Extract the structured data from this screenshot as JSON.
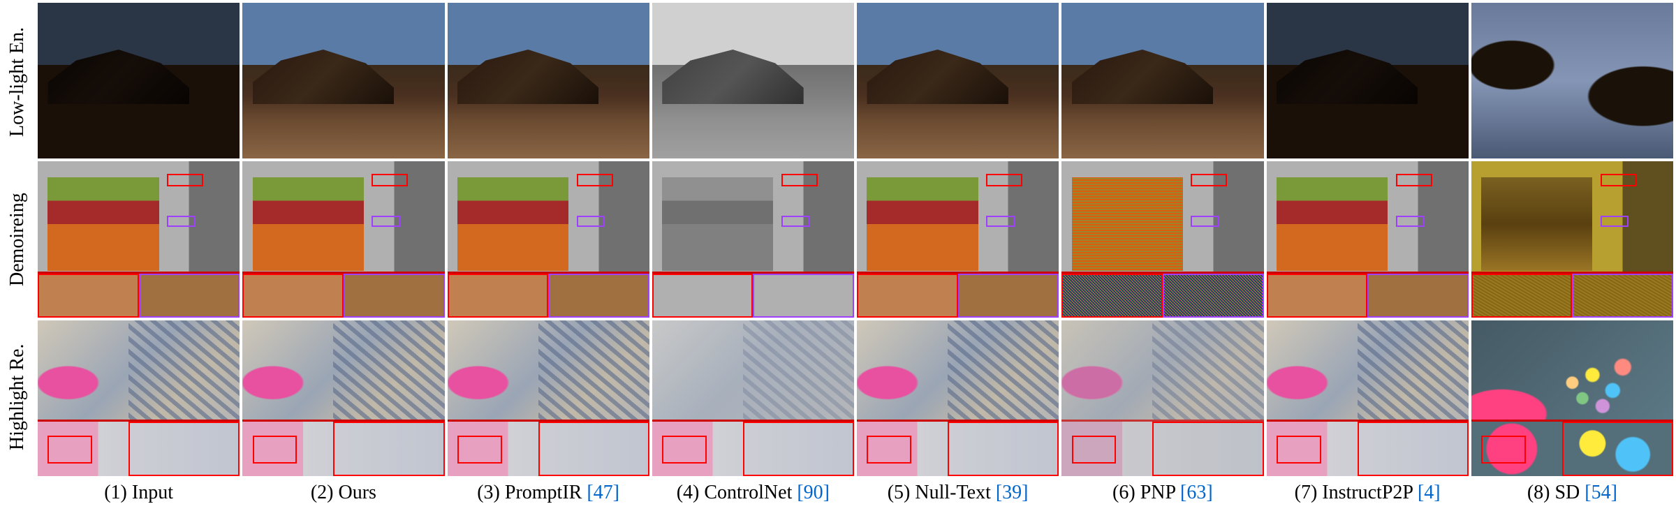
{
  "rows": {
    "r1": "Low-light En.",
    "r2": "Demoireing",
    "r3": "Highlight Re."
  },
  "captions": {
    "c1": {
      "label": "(1) Input",
      "ref": ""
    },
    "c2": {
      "label": "(2) Ours",
      "ref": ""
    },
    "c3": {
      "label": "(3) PromptIR ",
      "ref": "[47]"
    },
    "c4": {
      "label": "(4) ControlNet ",
      "ref": "[90]"
    },
    "c5": {
      "label": "(5) Null-Text ",
      "ref": "[39]"
    },
    "c6": {
      "label": "(6) PNP ",
      "ref": "[63]"
    },
    "c7": {
      "label": "(7) InstructP2P ",
      "ref": "[4]"
    },
    "c8": {
      "label": "(8) SD ",
      "ref": "[54]"
    }
  },
  "grid": {
    "rows": [
      "Low-light En.",
      "Demoireing",
      "Highlight Re."
    ],
    "columns": [
      "Input",
      "Ours",
      "PromptIR",
      "ControlNet",
      "Null-Text",
      "PNP",
      "InstructP2P",
      "SD"
    ],
    "row1_variants": [
      "dark",
      "normal",
      "normal",
      "gray",
      "normal",
      "normal",
      "dark",
      "tree"
    ],
    "row2_variants": [
      "normal",
      "normal",
      "normal",
      "flat",
      "normal",
      "noise",
      "normal",
      "yellow"
    ],
    "row3_variants": [
      "normal",
      "normal",
      "normal",
      "faded",
      "normal",
      "washed",
      "normal",
      "candy"
    ],
    "row2_insets": [
      "red-small",
      "purple-small",
      "red-big",
      "purple-big"
    ],
    "row3_insets": [
      "red-small",
      "red-big"
    ]
  }
}
